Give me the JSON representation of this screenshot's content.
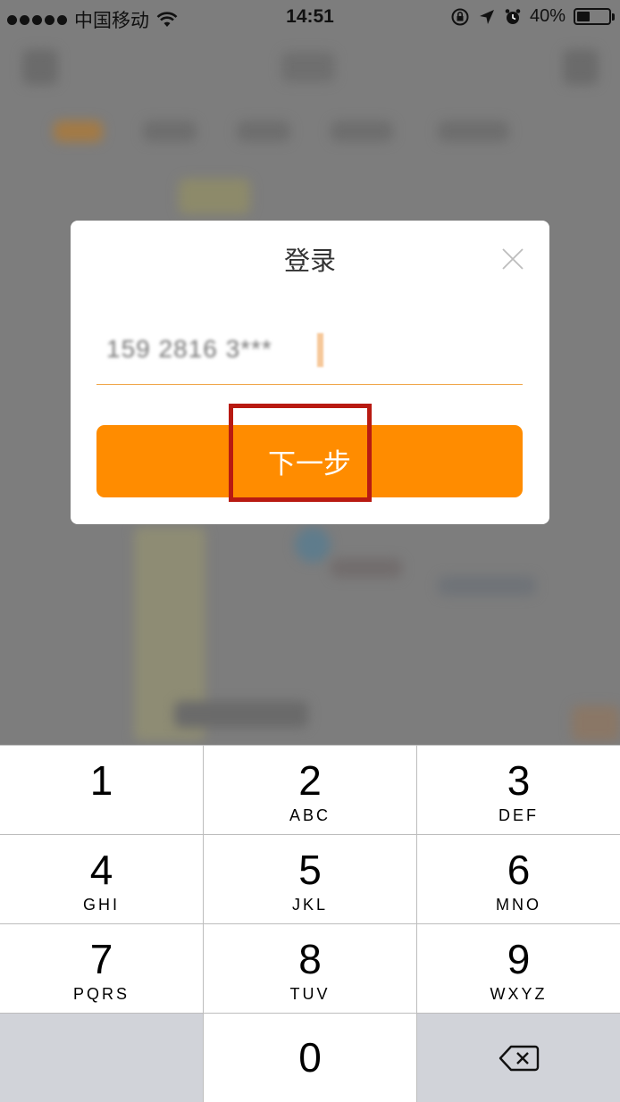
{
  "status_bar": {
    "carrier": "中国移动",
    "time": "14:51",
    "battery": "40%",
    "icons": [
      "signal-dots-icon",
      "wifi-icon",
      "rotation-lock-icon",
      "location-arrow-icon",
      "alarm-clock-icon",
      "battery-icon"
    ]
  },
  "dialog": {
    "title": "登录",
    "phone_value": "159 2816 3***",
    "next_button": "下一步",
    "accent_color": "#ff8c00",
    "highlight_color": "#b81a12"
  },
  "keypad": {
    "keys": [
      {
        "digit": "1",
        "letters": ""
      },
      {
        "digit": "2",
        "letters": "ABC"
      },
      {
        "digit": "3",
        "letters": "DEF"
      },
      {
        "digit": "4",
        "letters": "GHI"
      },
      {
        "digit": "5",
        "letters": "JKL"
      },
      {
        "digit": "6",
        "letters": "MNO"
      },
      {
        "digit": "7",
        "letters": "PQRS"
      },
      {
        "digit": "8",
        "letters": "TUV"
      },
      {
        "digit": "9",
        "letters": "WXYZ"
      }
    ],
    "zero": "0",
    "delete_icon": "backspace-icon"
  }
}
